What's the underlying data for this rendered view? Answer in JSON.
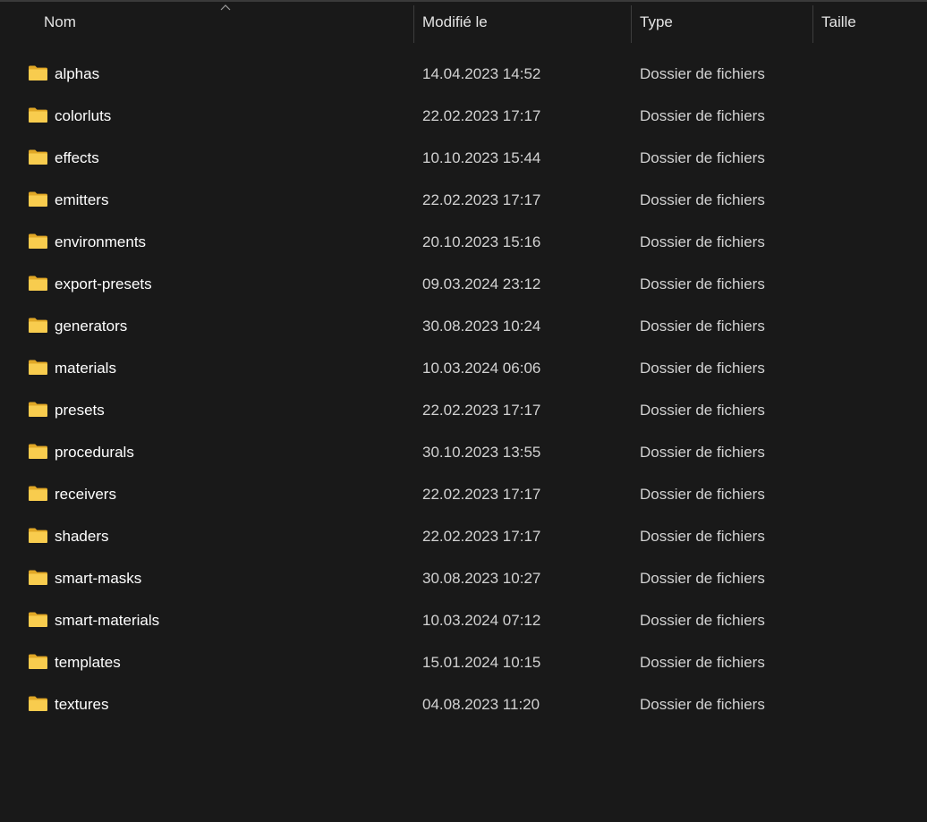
{
  "columns": {
    "name": "Nom",
    "modified": "Modifié le",
    "type": "Type",
    "size": "Taille"
  },
  "sort": {
    "column": "name",
    "direction": "ascending",
    "icon": "chevron-up-icon"
  },
  "colors": {
    "background": "#191919",
    "folder_front": "#f8cc4e",
    "folder_back": "#e0a726",
    "divider": "#3d3d3d"
  },
  "files": [
    {
      "name": "alphas",
      "modified": "14.04.2023 14:52",
      "type": "Dossier de fichiers",
      "icon": "folder-icon"
    },
    {
      "name": "colorluts",
      "modified": "22.02.2023 17:17",
      "type": "Dossier de fichiers",
      "icon": "folder-icon"
    },
    {
      "name": "effects",
      "modified": "10.10.2023 15:44",
      "type": "Dossier de fichiers",
      "icon": "folder-icon"
    },
    {
      "name": "emitters",
      "modified": "22.02.2023 17:17",
      "type": "Dossier de fichiers",
      "icon": "folder-icon"
    },
    {
      "name": "environments",
      "modified": "20.10.2023 15:16",
      "type": "Dossier de fichiers",
      "icon": "folder-icon"
    },
    {
      "name": "export-presets",
      "modified": "09.03.2024 23:12",
      "type": "Dossier de fichiers",
      "icon": "folder-icon"
    },
    {
      "name": "generators",
      "modified": "30.08.2023 10:24",
      "type": "Dossier de fichiers",
      "icon": "folder-icon"
    },
    {
      "name": "materials",
      "modified": "10.03.2024 06:06",
      "type": "Dossier de fichiers",
      "icon": "folder-icon"
    },
    {
      "name": "presets",
      "modified": "22.02.2023 17:17",
      "type": "Dossier de fichiers",
      "icon": "folder-icon"
    },
    {
      "name": "procedurals",
      "modified": "30.10.2023 13:55",
      "type": "Dossier de fichiers",
      "icon": "folder-icon"
    },
    {
      "name": "receivers",
      "modified": "22.02.2023 17:17",
      "type": "Dossier de fichiers",
      "icon": "folder-icon"
    },
    {
      "name": "shaders",
      "modified": "22.02.2023 17:17",
      "type": "Dossier de fichiers",
      "icon": "folder-icon"
    },
    {
      "name": "smart-masks",
      "modified": "30.08.2023 10:27",
      "type": "Dossier de fichiers",
      "icon": "folder-icon"
    },
    {
      "name": "smart-materials",
      "modified": "10.03.2024 07:12",
      "type": "Dossier de fichiers",
      "icon": "folder-icon"
    },
    {
      "name": "templates",
      "modified": "15.01.2024 10:15",
      "type": "Dossier de fichiers",
      "icon": "folder-icon"
    },
    {
      "name": "textures",
      "modified": "04.08.2023 11:20",
      "type": "Dossier de fichiers",
      "icon": "folder-icon"
    }
  ]
}
